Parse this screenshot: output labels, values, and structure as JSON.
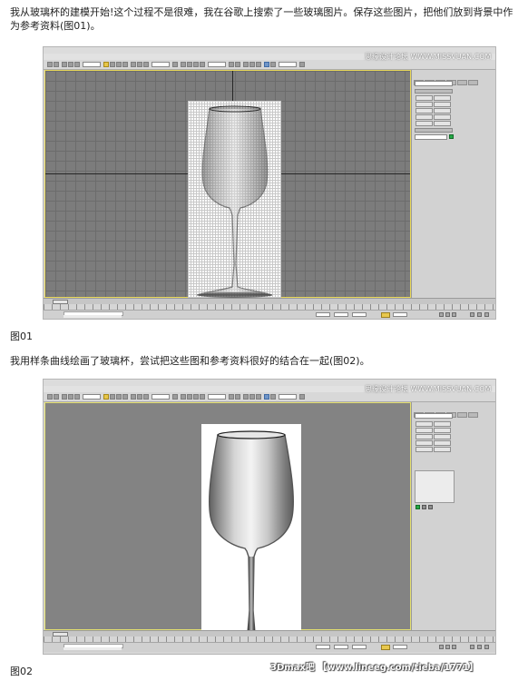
{
  "article": {
    "paragraph1": "我从玻璃杯的建模开始!这个过程不是很难，我在谷歌上搜索了一些玻璃图片。保存这些图片，把他们放到背景中作为参考资料(图01)。",
    "caption1": "图01",
    "paragraph2": "我用样条曲线绘画了玻璃杯，尝试把这些图和参考资料很好的结合在一起(图02)。",
    "caption2": "图02",
    "footer_watermark": "3Dmax吧 【www.lineeg.com/tieba/1771】"
  },
  "screenshots": [
    {
      "id": "fig01",
      "menu_items": [
        "File",
        "Edit",
        "Tools",
        "Group",
        "Views",
        "Create",
        "Modifiers",
        "Animation",
        "Graph Editors",
        "Rendering",
        "Lighting Analysis",
        "Customize",
        "MAXScript",
        "Help"
      ],
      "watermark": "思缘设计论坛 WWW.MISSVUAN.COM",
      "viewport_style": "grid",
      "status_text": "None Selected"
    },
    {
      "id": "fig02",
      "menu_items": [
        "File",
        "Edit",
        "Tools",
        "Group",
        "Views",
        "Create",
        "Modifiers",
        "Animation",
        "Graph Editors",
        "Rendering",
        "Lighting Analysis",
        "Customize",
        "MAXScript",
        "Help"
      ],
      "watermark": "思缘设计论坛 WWW.MISSVUAN.COM",
      "viewport_style": "plain",
      "status_text": "None Selected"
    }
  ],
  "colors": {
    "viewport_border": "#e8d85a",
    "object_color": "#23a845",
    "key_button": "#e8c84e"
  },
  "icons": [
    "select-icon",
    "move-icon",
    "rotate-icon",
    "scale-icon",
    "snap-icon",
    "render-icon",
    "play-icon",
    "zoom-icon"
  ]
}
